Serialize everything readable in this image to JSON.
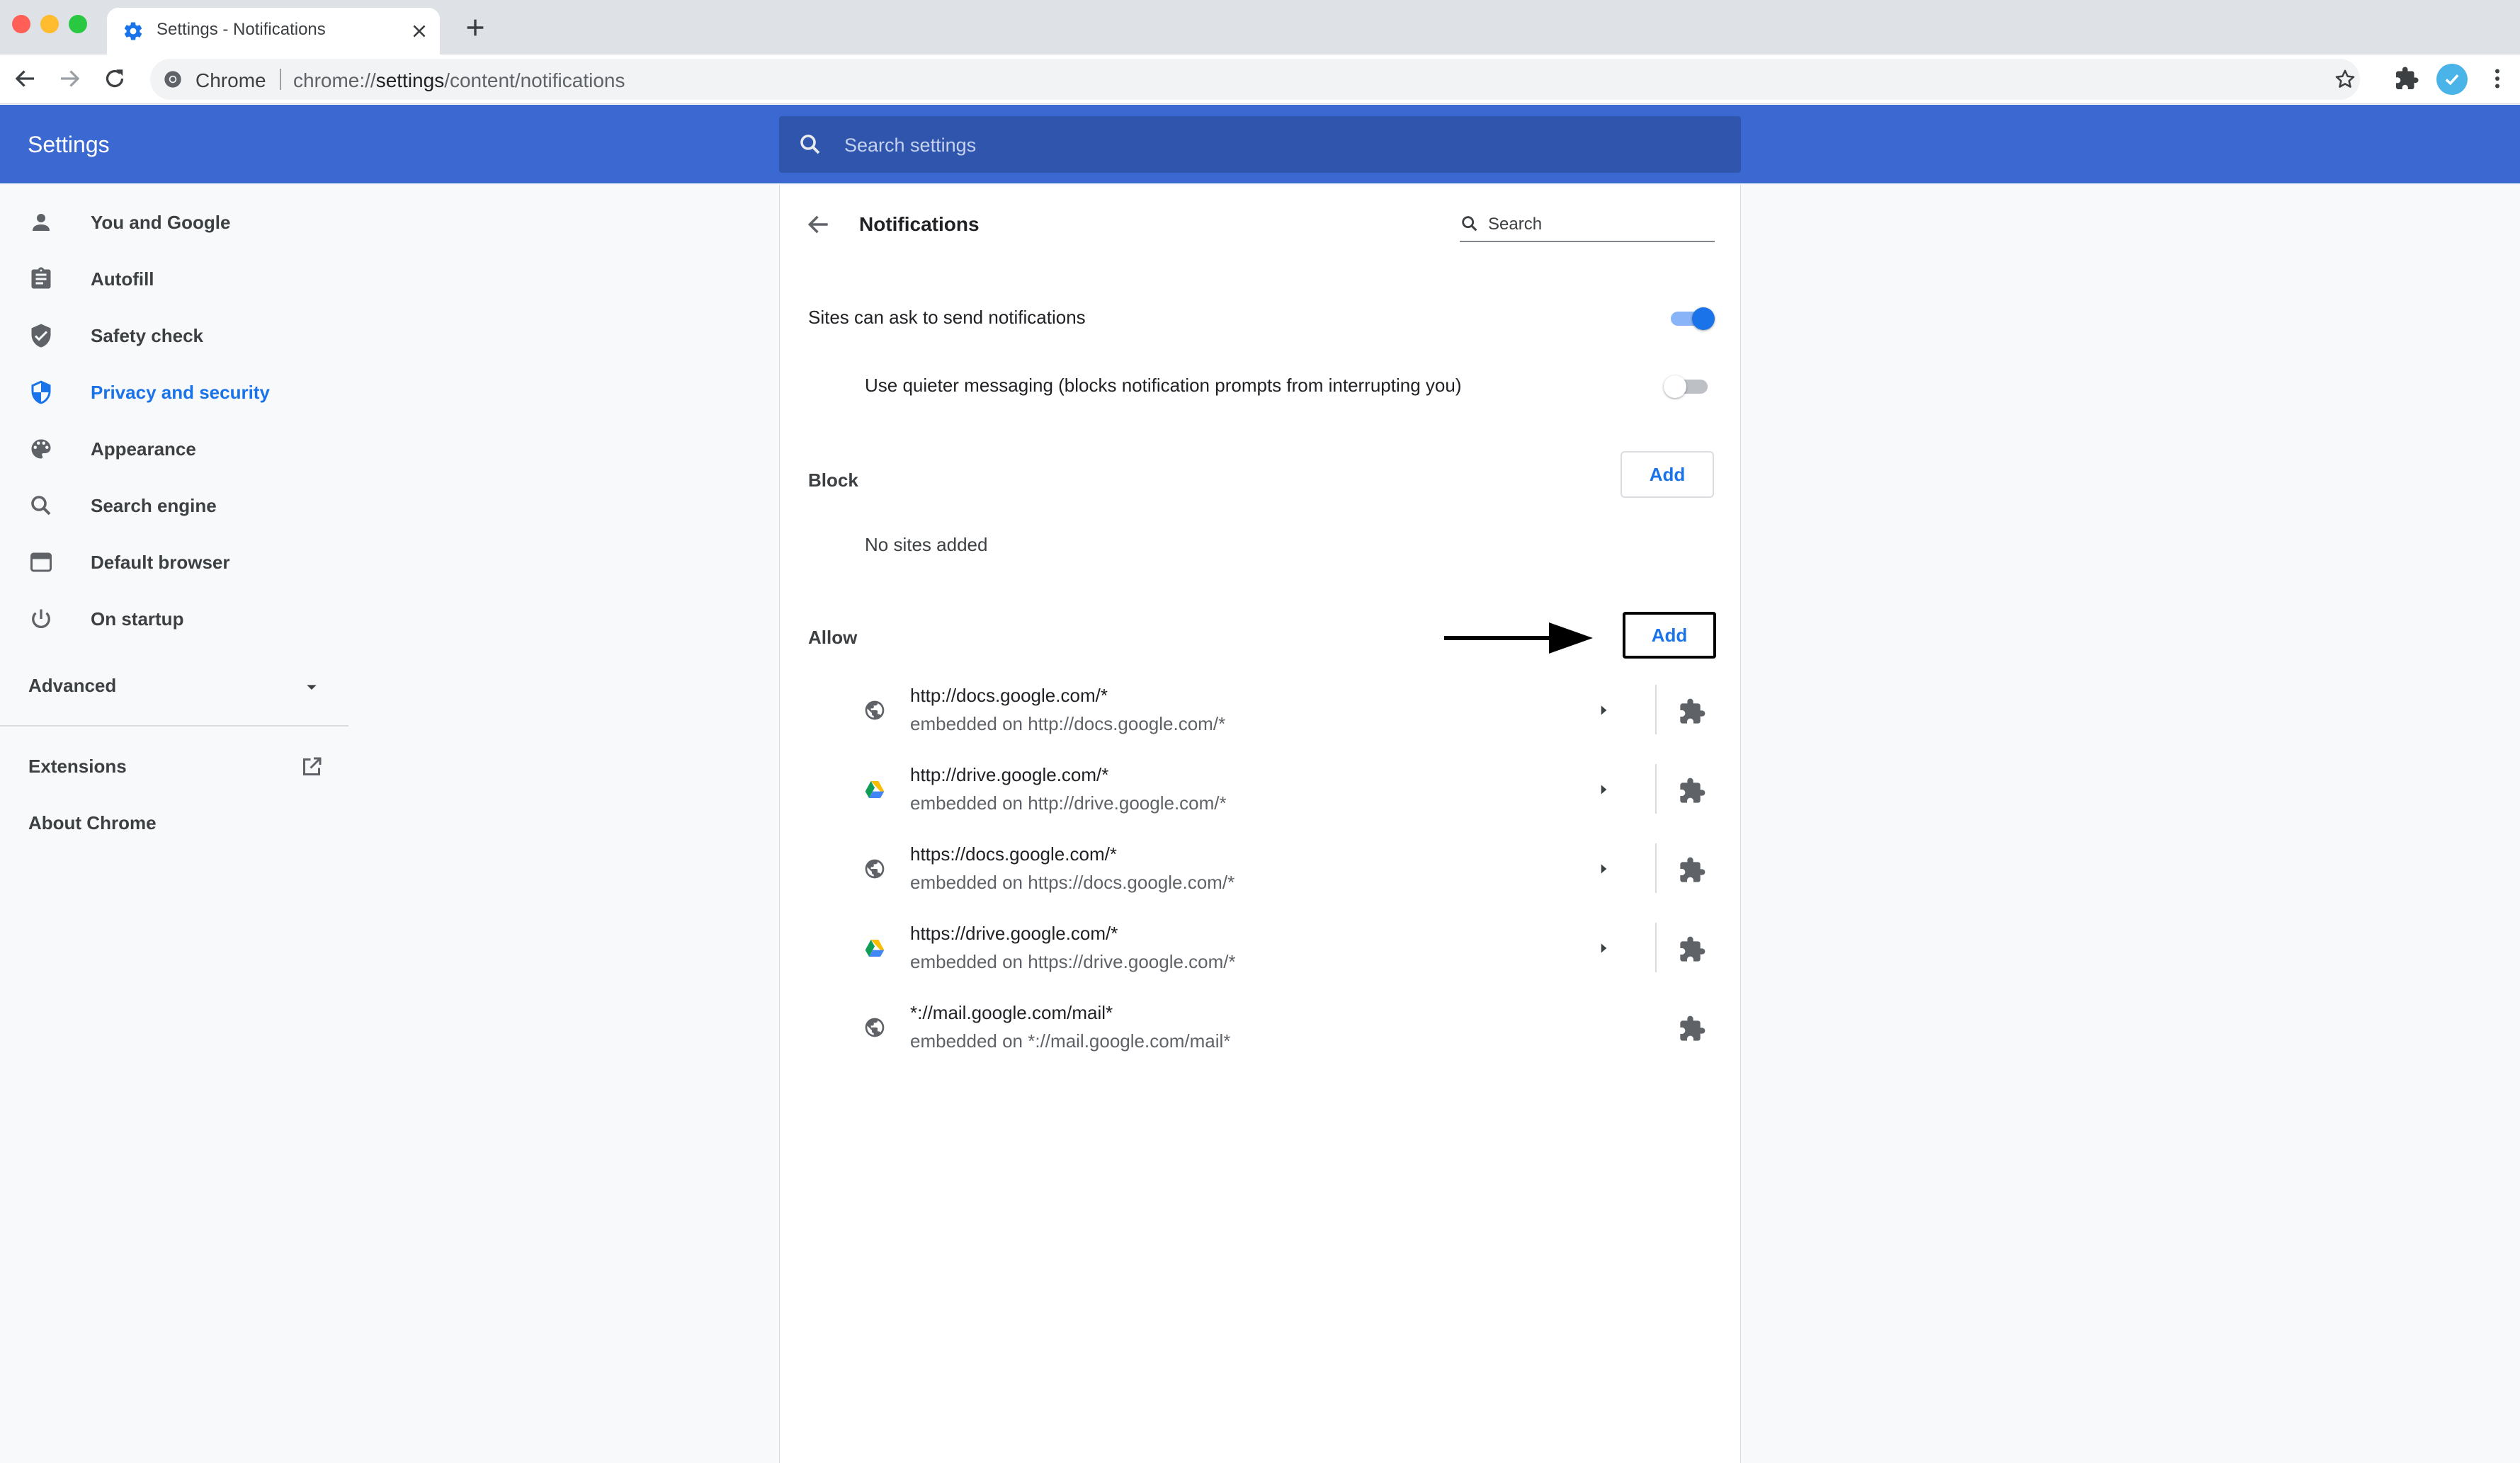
{
  "browser": {
    "tab_title": "Settings - Notifications",
    "omnibox_site": "Chrome",
    "url_prefix": "chrome://",
    "url_host": "settings",
    "url_path": "/content/notifications"
  },
  "header": {
    "title": "Settings",
    "search_placeholder": "Search settings"
  },
  "sidebar": {
    "items": [
      {
        "label": "You and Google",
        "icon": "person-icon"
      },
      {
        "label": "Autofill",
        "icon": "clipboard-icon"
      },
      {
        "label": "Safety check",
        "icon": "shield-check-icon"
      },
      {
        "label": "Privacy and security",
        "icon": "shield-icon",
        "active": true
      },
      {
        "label": "Appearance",
        "icon": "palette-icon"
      },
      {
        "label": "Search engine",
        "icon": "search-icon"
      },
      {
        "label": "Default browser",
        "icon": "browser-window-icon"
      },
      {
        "label": "On startup",
        "icon": "power-icon"
      }
    ],
    "advanced": "Advanced",
    "extensions": "Extensions",
    "about": "About Chrome"
  },
  "main": {
    "title": "Notifications",
    "search_placeholder": "Search",
    "ask_label": "Sites can ask to send notifications",
    "ask_enabled": true,
    "quiet_label": "Use quieter messaging (blocks notification prompts from interrupting you)",
    "quiet_enabled": false,
    "block": {
      "label": "Block",
      "add_label": "Add",
      "empty_text": "No sites added"
    },
    "allow": {
      "label": "Allow",
      "add_label": "Add",
      "sites": [
        {
          "pattern": "http://docs.google.com/*",
          "embedded": "embedded on http://docs.google.com/*",
          "icon": "globe-icon",
          "expandable": true
        },
        {
          "pattern": "http://drive.google.com/*",
          "embedded": "embedded on http://drive.google.com/*",
          "icon": "drive-icon",
          "expandable": true
        },
        {
          "pattern": "https://docs.google.com/*",
          "embedded": "embedded on https://docs.google.com/*",
          "icon": "globe-icon",
          "expandable": true
        },
        {
          "pattern": "https://drive.google.com/*",
          "embedded": "embedded on https://drive.google.com/*",
          "icon": "drive-icon",
          "expandable": true
        },
        {
          "pattern": "*://mail.google.com/mail*",
          "embedded": "embedded on *://mail.google.com/mail*",
          "icon": "globe-icon",
          "expandable": false
        }
      ]
    }
  },
  "colors": {
    "accent": "#1a73e8",
    "header_bg": "#3b68d1",
    "header_search_bg": "#2f55ad"
  }
}
